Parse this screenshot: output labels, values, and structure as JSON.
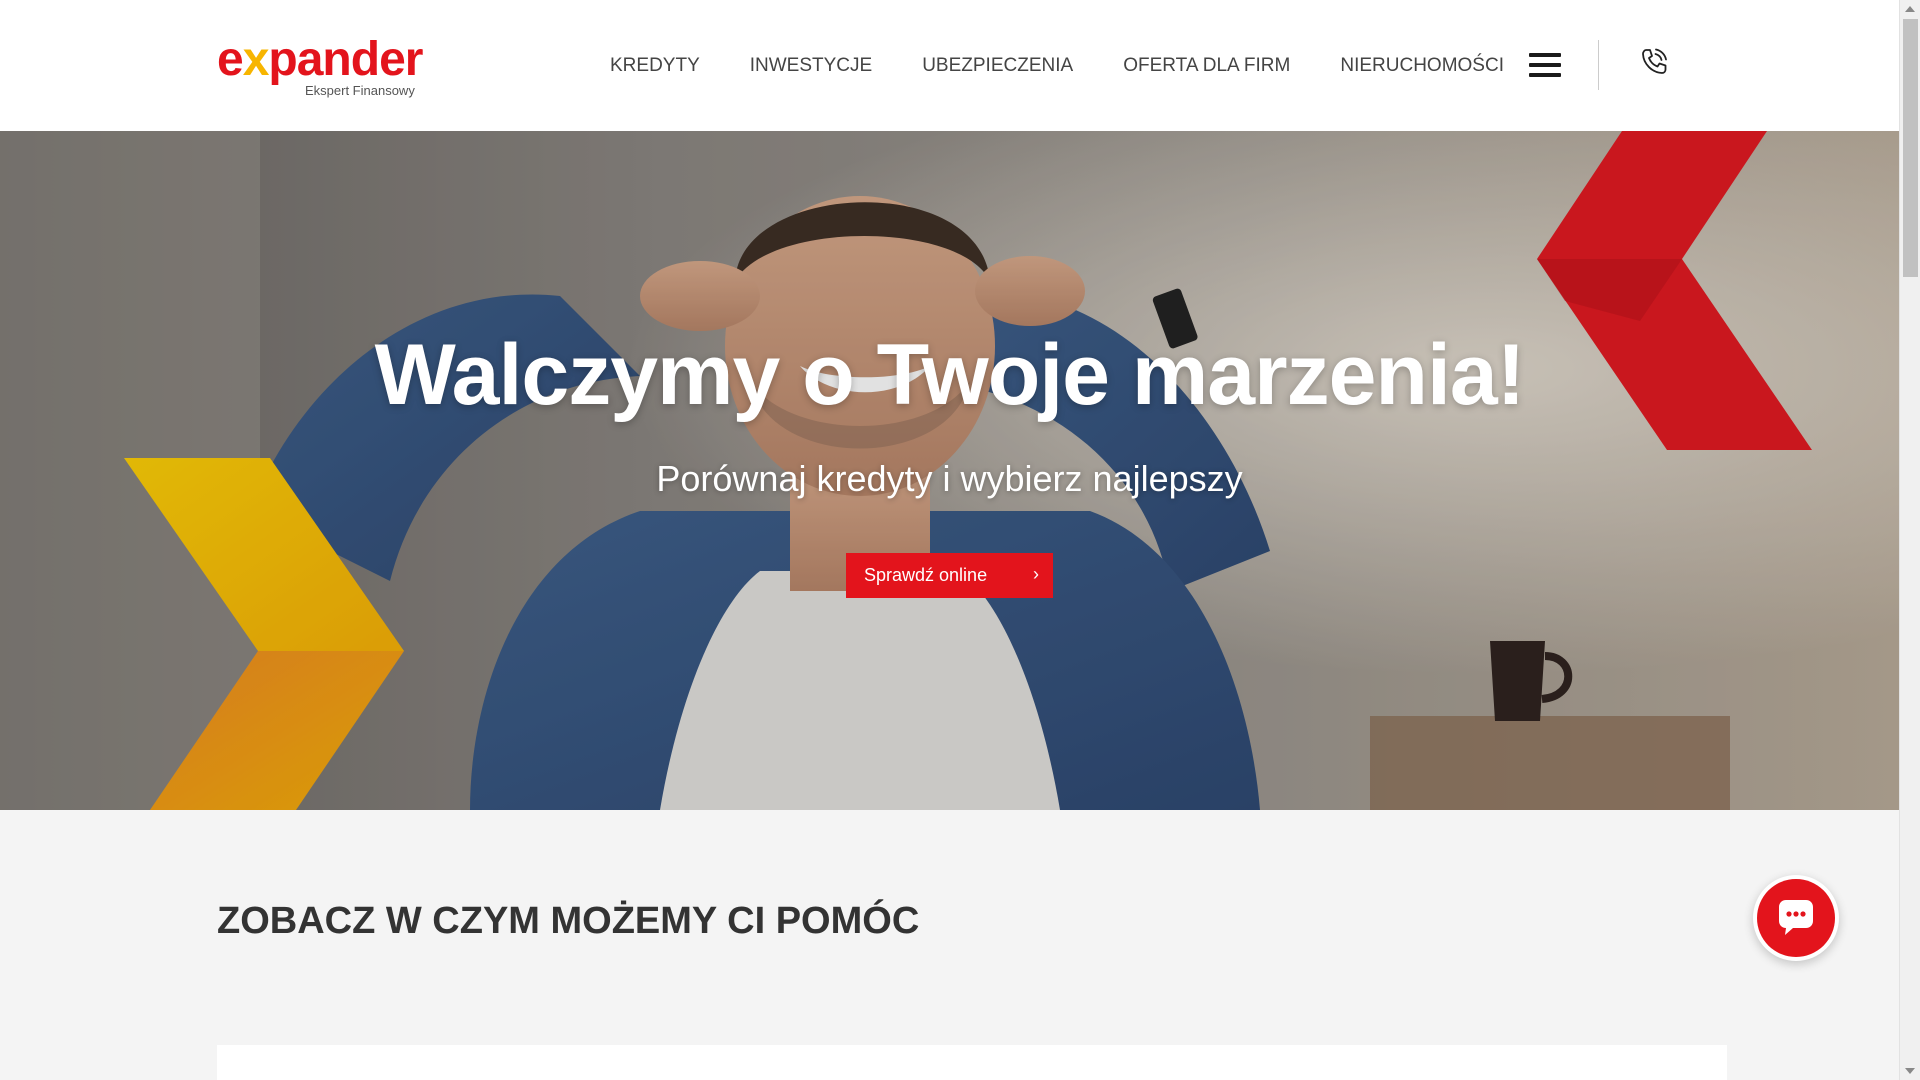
{
  "header": {
    "logo": {
      "word": "expander",
      "tagline": "Ekspert Finansowy"
    },
    "nav": [
      {
        "label": "KREDYTY"
      },
      {
        "label": "INWESTYCJE"
      },
      {
        "label": "UBEZPIECZENIA"
      },
      {
        "label": "OFERTA DLA FIRM"
      },
      {
        "label": "NIERUCHOMOŚCI"
      }
    ],
    "menu_icon": "hamburger-menu-icon",
    "phone_icon": "phone-icon"
  },
  "hero": {
    "title": "Walczymy o Twoje marzenia!",
    "subtitle": "Porównaj kredyty i wybierz najlepszy",
    "cta_label": "Sprawdź online",
    "cta_icon": "chevron-right-icon"
  },
  "section": {
    "title": "ZOBACZ W CZYM MOŻEMY CI POMÓC"
  },
  "chat": {
    "icon": "chat-bubble-icon"
  },
  "colors": {
    "brand_red": "#e3141c",
    "brand_yellow": "#f7b500",
    "brand_orange": "#f08020",
    "text_dark": "#333333",
    "nav_text": "#444444"
  }
}
